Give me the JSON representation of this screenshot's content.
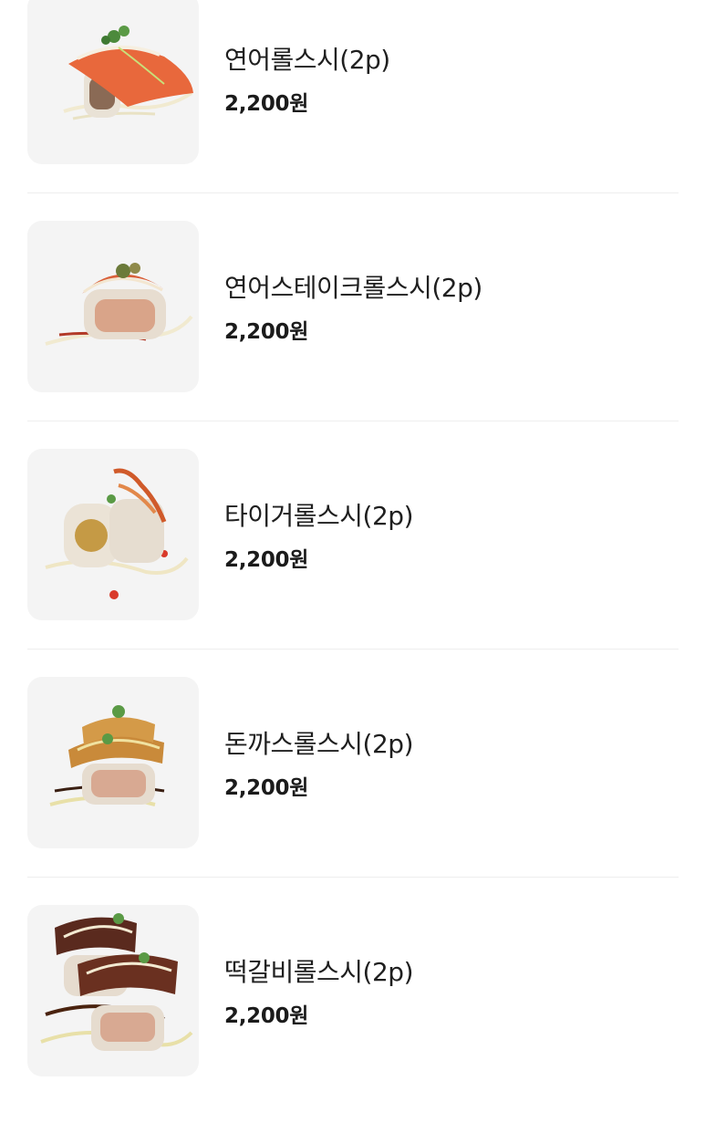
{
  "menu": {
    "items": [
      {
        "name": "연어롤스시(2p)",
        "price": "2,200원",
        "image": "salmon-roll-sushi-photo"
      },
      {
        "name": "연어스테이크롤스시(2p)",
        "price": "2,200원",
        "image": "salmon-steak-roll-sushi-photo"
      },
      {
        "name": "타이거롤스시(2p)",
        "price": "2,200원",
        "image": "tiger-roll-sushi-photo"
      },
      {
        "name": "돈까스롤스시(2p)",
        "price": "2,200원",
        "image": "pork-cutlet-roll-sushi-photo"
      },
      {
        "name": "떡갈비롤스시(2p)",
        "price": "2,200원",
        "image": "tteokgalbi-roll-sushi-photo"
      }
    ]
  },
  "colors": {
    "thumb_background": "#f4f4f4",
    "divider": "#eeeeee",
    "text": "#1b1b1b"
  }
}
